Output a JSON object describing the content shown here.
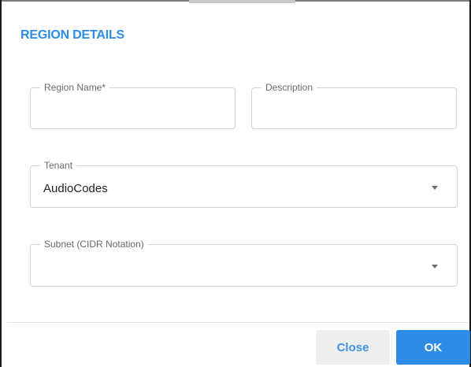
{
  "dialog": {
    "title": "REGION DETAILS",
    "fields": {
      "region_name": {
        "label": "Region Name*",
        "value": ""
      },
      "description": {
        "label": "Description",
        "value": ""
      },
      "tenant": {
        "label": "Tenant",
        "value": "AudioCodes",
        "icon": "chevron-down-icon"
      },
      "subnet": {
        "label": "Subnet (CIDR Notation)",
        "value": "",
        "icon": "chevron-down-icon"
      }
    },
    "buttons": {
      "close_label": "Close",
      "ok_label": "OK"
    }
  },
  "colors": {
    "accent": "#2c8ce6",
    "close_bg": "#eeeeee",
    "border": "#d4d4d4",
    "label": "#6a6a6a"
  }
}
